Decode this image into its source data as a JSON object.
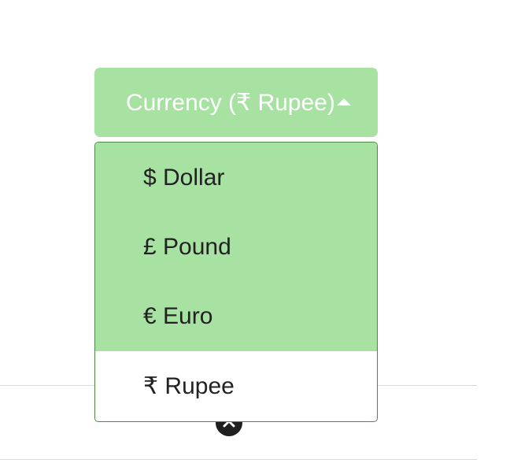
{
  "currency_dropdown": {
    "toggle_label": "Currency (₹ Rupee)",
    "items": [
      {
        "label": "$ Dollar",
        "selected": false
      },
      {
        "label": "£ Pound",
        "selected": false
      },
      {
        "label": "€ Euro",
        "selected": false
      },
      {
        "label": "₹ Rupee",
        "selected": true
      }
    ]
  },
  "colors": {
    "accent_green": "#a8e2a3",
    "menu_border": "#4a8a44",
    "scroll_button": "#1f1f1f"
  },
  "icons": {
    "caret": "caret-up-icon",
    "scroll_top": "chevron-up-icon"
  }
}
